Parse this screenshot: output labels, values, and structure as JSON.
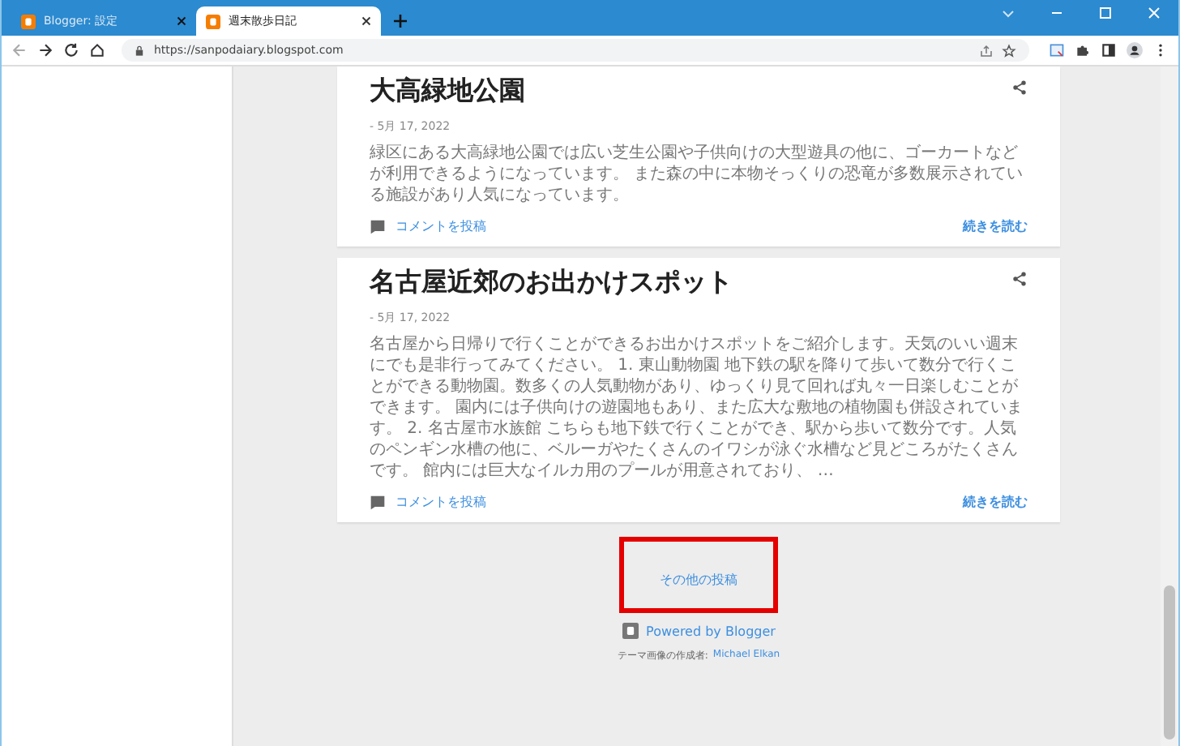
{
  "browser": {
    "tabs": [
      {
        "title": "Blogger: 設定",
        "selected": false
      },
      {
        "title": "週末散歩日記",
        "selected": true
      }
    ],
    "url": "https://sanpodaiary.blogspot.com"
  },
  "posts": [
    {
      "title": "大高緑地公園",
      "date": "- 5月 17, 2022",
      "snippet": "緑区にある大高緑地公園では広い芝生公園や子供向けの大型遊具の他に、ゴーカートなどが利用できるようになっています。 また森の中に本物そっくりの恐竜が多数展示されている施設があり人気になっています。",
      "comment_link": "コメントを投稿",
      "read_more": "続きを読む"
    },
    {
      "title": "名古屋近郊のお出かけスポット",
      "date": "- 5月 17, 2022",
      "snippet": "名古屋から日帰りで行くことができるお出かけスポットをご紹介します。天気のいい週末にでも是非行ってみてください。 1. 東山動物園 地下鉄の駅を降りて歩いて数分で行くことができる動物園。数多くの人気動物があり、ゆっくり見て回れば丸々一日楽しむことができます。 園内には子供向けの遊園地もあり、また広大な敷地の植物園も併設されています。 2. 名古屋市水族館 こちらも地下鉄で行くことができ、駅から歩いて数分です。人気のペンギン水槽の他に、ベルーガやたくさんのイワシが泳ぐ水槽など見どころがたくさんです。 館内には巨大なイルカ用のプールが用意されており、 …",
      "comment_link": "コメントを投稿",
      "read_more": "続きを読む"
    }
  ],
  "more_posts": {
    "label": "その他の投稿",
    "highlighted": true
  },
  "footer": {
    "powered_by": "Powered by Blogger",
    "credit": "テーマ画像の作成者:",
    "credit_author": "Michael Elkan"
  }
}
